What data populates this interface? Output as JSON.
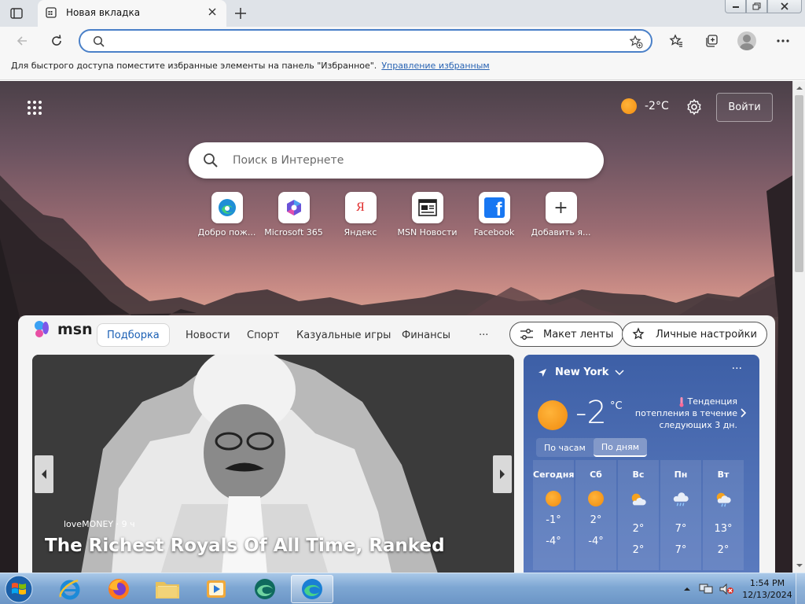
{
  "browser": {
    "tab": {
      "title": "Новая вкладка"
    },
    "address": {
      "value": "",
      "placeholder": ""
    },
    "favorites_bar": {
      "message": "Для быстрого доступа поместите избранные элементы на панель \"Избранное\".",
      "link": "Управление избранным"
    }
  },
  "newtab": {
    "weather": {
      "temp": "-2°C"
    },
    "login_label": "Войти",
    "search": {
      "placeholder": "Поиск в Интернете"
    },
    "quick_links": [
      {
        "label": "Добро пож...",
        "icon": "edge-icon"
      },
      {
        "label": "Microsoft 365",
        "icon": "m365-icon"
      },
      {
        "label": "Яндекс",
        "icon": "yandex-icon",
        "letter": "Я"
      },
      {
        "label": "MSN Новости",
        "icon": "msn-news-icon"
      },
      {
        "label": "Facebook",
        "icon": "facebook-icon",
        "letter": "f"
      },
      {
        "label": "Добавить я...",
        "icon": "add-icon",
        "letter": "+"
      }
    ]
  },
  "msn": {
    "logo": "msn",
    "tabs": [
      "Подборка",
      "Новости",
      "Спорт",
      "Казуальные игры",
      "Финансы"
    ],
    "more": "···",
    "layout_button": "Макет ленты",
    "personalize_button": "Личные настройки",
    "hero": {
      "source": "loveMONEY",
      "age": "· 9 ч",
      "headline": "The Richest Royals Of All Time, Ranked"
    },
    "weather": {
      "location": "New York",
      "temp": "-2",
      "unit": "°C",
      "trend": "Тенденция потепления в течение следующих 3 дн.",
      "toggle": [
        "По часам",
        "По дням"
      ],
      "more": "···",
      "days": [
        {
          "name": "Сегодня",
          "icon": "sun-icon",
          "hi": "-1°",
          "lo": "-4°"
        },
        {
          "name": "Сб",
          "icon": "sun-icon",
          "hi": "2°",
          "lo": "-4°"
        },
        {
          "name": "Вс",
          "icon": "partly-cloudy-icon",
          "hi": "2°",
          "lo": "2°"
        },
        {
          "name": "Пн",
          "icon": "rain-cloud-icon",
          "hi": "7°",
          "lo": "7°"
        },
        {
          "name": "Вт",
          "icon": "partly-cloudy-rain-icon",
          "hi": "13°",
          "lo": "2°"
        }
      ]
    }
  },
  "taskbar": {
    "time": "1:54 PM",
    "date": "12/13/2024"
  },
  "colors": {
    "accent": "#1a5fb4",
    "sun": "#f59a1b",
    "weather_card": "#4a6bb0"
  }
}
